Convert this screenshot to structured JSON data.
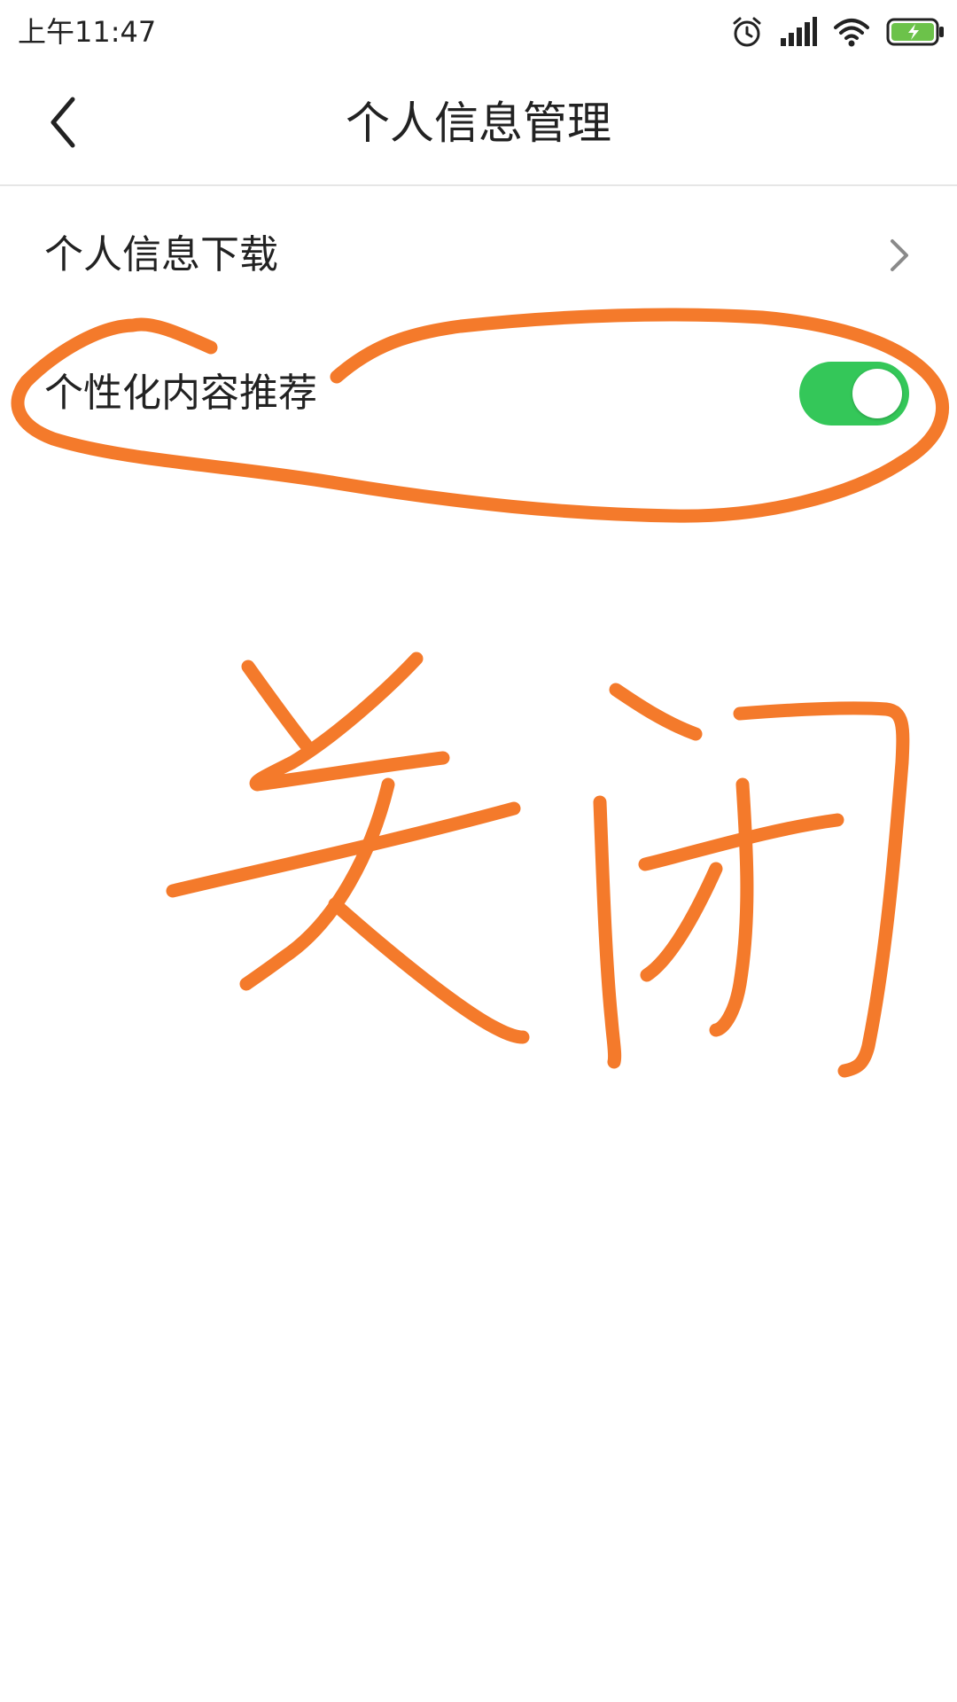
{
  "status_bar": {
    "time": "上午11:47",
    "icons": [
      "alarm-icon",
      "signal-icon",
      "wifi-icon",
      "battery-charging-icon"
    ],
    "battery_color": "#6cc24a"
  },
  "header": {
    "title": "个人信息管理",
    "back_icon": "chevron-left-icon"
  },
  "settings": [
    {
      "label": "个人信息下载",
      "control": "chevron-right-icon"
    },
    {
      "label": "个性化内容推荐",
      "control": "toggle",
      "enabled": true
    }
  ],
  "annotation": {
    "handwritten_text": "关闭",
    "color": "#f47a2b"
  },
  "colors": {
    "toggle_on": "#34c759",
    "text_primary": "#222222",
    "divider": "#e6e6e6"
  }
}
